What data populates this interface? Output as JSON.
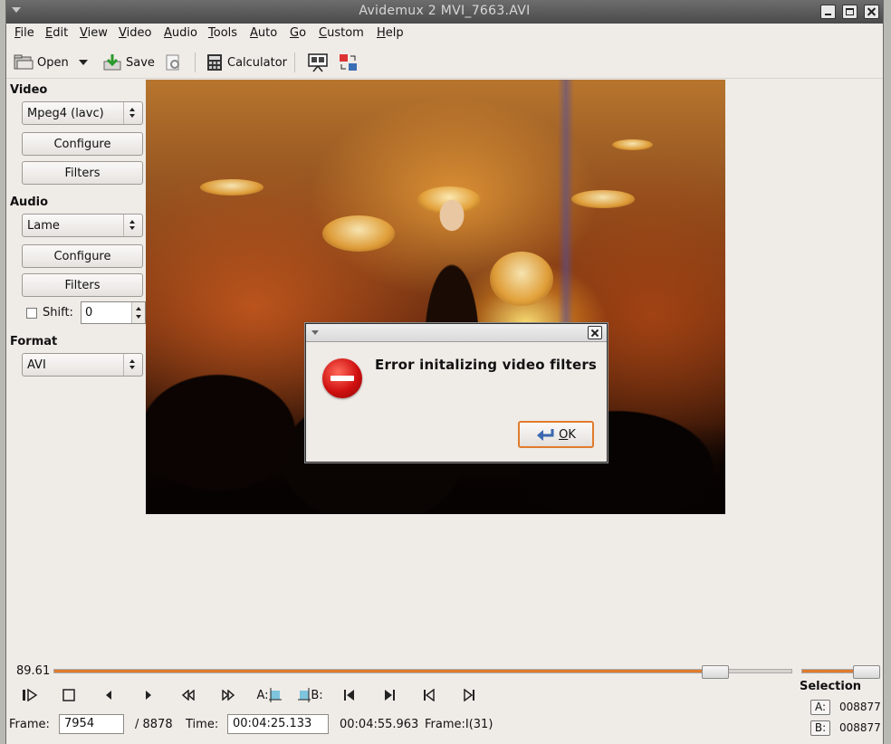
{
  "window": {
    "title": "Avidemux 2 MVI_7663.AVI"
  },
  "menu": [
    "File",
    "Edit",
    "View",
    "Video",
    "Audio",
    "Tools",
    "Auto",
    "Go",
    "Custom",
    "Help"
  ],
  "toolbar": {
    "open_label": "Open",
    "save_label": "Save",
    "calculator_label": "Calculator"
  },
  "sidebar": {
    "video_heading": "Video",
    "video_codec": "Mpeg4 (lavc)",
    "video_configure": "Configure",
    "video_filters": "Filters",
    "audio_heading": "Audio",
    "audio_codec": "Lame",
    "audio_configure": "Configure",
    "audio_filters": "Filters",
    "shift_label": "Shift:",
    "shift_value": "0",
    "format_heading": "Format",
    "format_value": "AVI"
  },
  "dialog": {
    "message": "Error initalizing video filters",
    "ok_label": "OK"
  },
  "timeline": {
    "position_label": "89.61",
    "progress_fraction": 0.8961
  },
  "navigation": {
    "a_marker": "A:",
    "b_marker": "B:"
  },
  "status": {
    "frame_label": "Frame:",
    "frame_value": "7954",
    "frame_total": "/ 8878",
    "time_label": "Time:",
    "time_value": "00:04:25.133",
    "duration": "00:04:55.963",
    "frame_type": "Frame:I(31)"
  },
  "selection": {
    "heading": "Selection",
    "a_label": "A:",
    "a_value": "008877",
    "b_label": "B:",
    "b_value": "008877"
  },
  "colors": {
    "accent": "#e07b2c",
    "error": "#d01010"
  }
}
